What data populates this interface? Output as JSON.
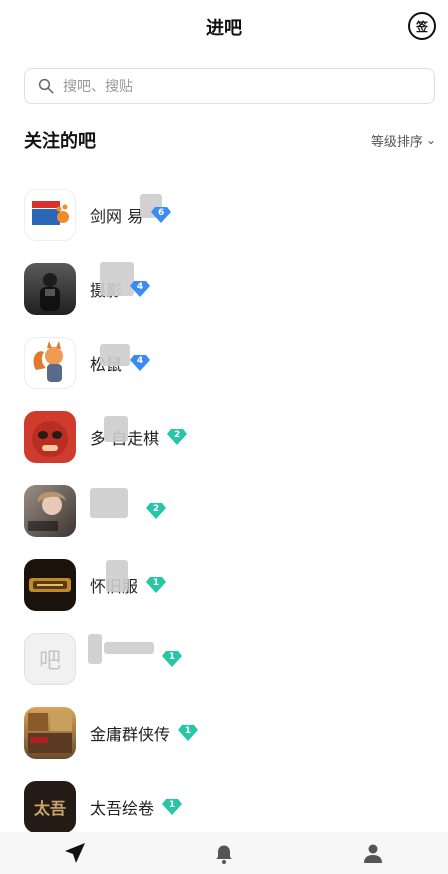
{
  "header": {
    "title": "进吧",
    "sign_label": "签"
  },
  "search": {
    "placeholder": "搜吧、搜贴"
  },
  "section": {
    "title": "关注的吧",
    "sort_label": "等级排序"
  },
  "colors": {
    "level_blue": "#3a8cf0",
    "level_green": "#28c6a8"
  },
  "forums": [
    {
      "name": "剑网 易",
      "level": "6",
      "level_color": "blue"
    },
    {
      "name": "  摄影",
      "level": "4",
      "level_color": "blue"
    },
    {
      "name": "  松鼠",
      "level": "4",
      "level_color": "blue"
    },
    {
      "name": "多  自走棋",
      "level": "2",
      "level_color": "green"
    },
    {
      "name": "",
      "level": "2",
      "level_color": "green"
    },
    {
      "name": "  怀旧服",
      "level": "1",
      "level_color": "green"
    },
    {
      "name": "",
      "level": "1",
      "level_color": "green"
    },
    {
      "name": "金庸群侠传",
      "level": "1",
      "level_color": "green"
    },
    {
      "name": "太吾绘卷",
      "level": "1",
      "level_color": "green"
    }
  ],
  "avatars": {
    "default_label": "吧",
    "taiwu_label": "太吾"
  },
  "nav": {
    "items": [
      "navigate-icon",
      "bell-icon",
      "person-icon"
    ]
  }
}
